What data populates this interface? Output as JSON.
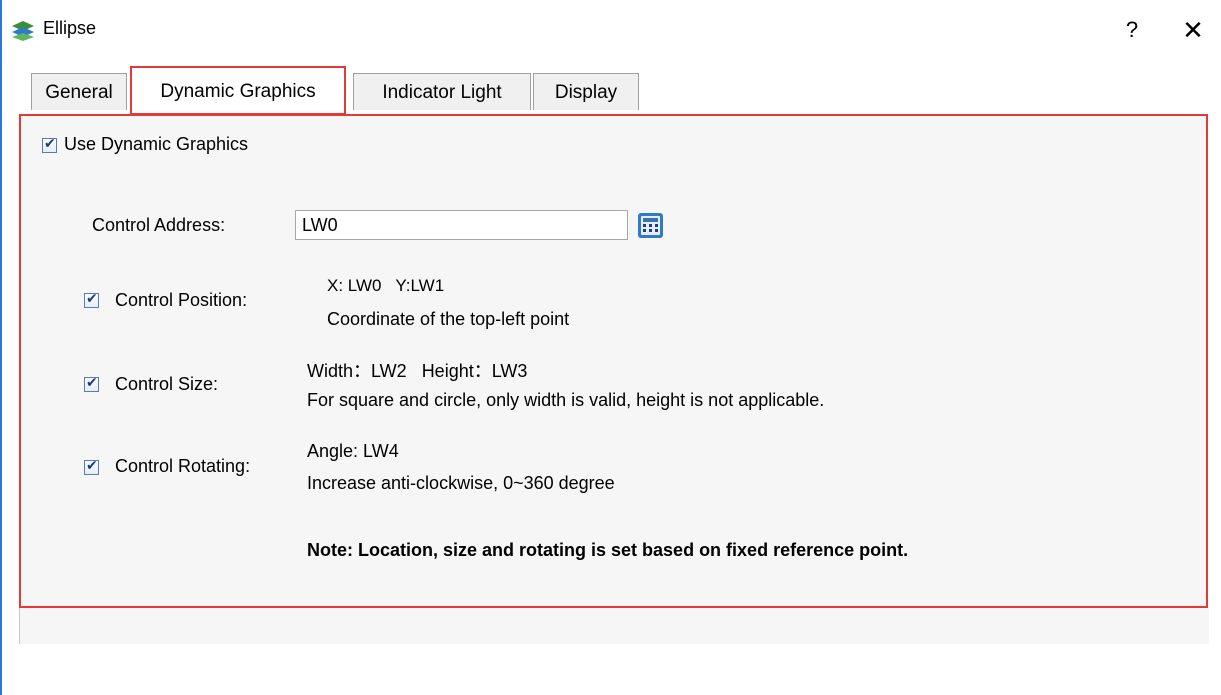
{
  "window": {
    "title": "Ellipse",
    "help_label": "?",
    "close_label": "✕"
  },
  "tabs": [
    {
      "label": "General"
    },
    {
      "label": "Dynamic Graphics",
      "active": true
    },
    {
      "label": "Indicator Light"
    },
    {
      "label": "Display"
    }
  ],
  "panel": {
    "use_dynamic": {
      "label": "Use Dynamic Graphics",
      "checked": true
    },
    "control_address": {
      "label": "Control Address:",
      "value": "LW0"
    },
    "position": {
      "label": "Control Position:",
      "checked": true,
      "line1": "X: LW0   Y:LW1",
      "line2": "Coordinate of the top-left point"
    },
    "size": {
      "label": "Control Size:",
      "checked": true,
      "line1": "Width：LW2   Height：LW3",
      "line2": "For square and circle, only width is valid, height is not applicable."
    },
    "rotating": {
      "label": "Control Rotating:",
      "checked": true,
      "line1": "Angle: LW4",
      "line2": "Increase anti-clockwise, 0~360 degree"
    },
    "note": "Note: Location, size and rotating is set based on fixed reference point."
  },
  "icons": {
    "app": "ellipse-app-icon",
    "keypad": "keypad-icon"
  },
  "colors": {
    "highlight": "#e53935",
    "panel_bg": "#f6f6f6"
  }
}
